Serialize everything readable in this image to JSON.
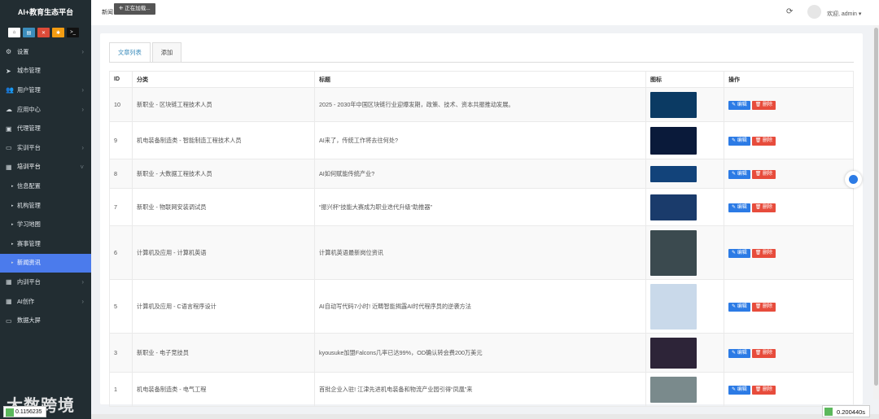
{
  "app": {
    "brand": "AI+教育生态平台",
    "breadcrumb": "新闻",
    "loading": "正在加载...",
    "welcome": "欢迎, admin ▾"
  },
  "sidebar": {
    "items": [
      {
        "label": "设置",
        "icon": "gear-icon",
        "has_arrow": true
      },
      {
        "label": "城市管理",
        "icon": "send-icon",
        "has_arrow": false
      },
      {
        "label": "用户管理",
        "icon": "users-icon",
        "has_arrow": true
      },
      {
        "label": "应用中心",
        "icon": "cloud-icon",
        "has_arrow": true
      },
      {
        "label": "代理管理",
        "icon": "id-card-icon",
        "has_arrow": false
      },
      {
        "label": "实训平台",
        "icon": "monitor-icon",
        "has_arrow": true
      },
      {
        "label": "培训平台",
        "icon": "grid-icon",
        "has_arrow": true,
        "open": true
      },
      {
        "label": "信息配置",
        "sub": true
      },
      {
        "label": "机构管理",
        "sub": true
      },
      {
        "label": "学习地图",
        "sub": true
      },
      {
        "label": "赛事管理",
        "sub": true
      },
      {
        "label": "新闻资讯",
        "sub": true,
        "active": true
      },
      {
        "label": "内训平台",
        "icon": "grid-icon",
        "has_arrow": true
      },
      {
        "label": "AI创作",
        "icon": "grid-icon",
        "has_arrow": true
      },
      {
        "label": "数据大屏",
        "icon": "desktop-icon",
        "has_arrow": false
      }
    ]
  },
  "tabs": [
    "文章列表",
    "添加"
  ],
  "table": {
    "headers": [
      "ID",
      "分类",
      "标题",
      "图标",
      "操作"
    ],
    "edit_label": "✎ 编辑",
    "delete_label": "🗑 删除",
    "rows": [
      {
        "id": "10",
        "category": "新职业 - 区块链工程技术人员",
        "title": "2025 - 2030年中国区块链行业迎爆发期，政策、技术、资本共振推动发展。",
        "thumb_color": "#0b3a63"
      },
      {
        "id": "9",
        "category": "机电装备制造类 - 智能制造工程技术人员",
        "title": "AI来了，传统工作将去往何处?",
        "thumb_color": "#0a1a3a"
      },
      {
        "id": "8",
        "category": "新职业 - 大数据工程技术人员",
        "title": "AI如何赋能传统产业?",
        "thumb_color": "#12437a"
      },
      {
        "id": "7",
        "category": "新职业 - 物联网安装调试员",
        "title": "“振兴杯”技能大赛成为职业迭代升级“助推器”",
        "thumb_color": "#1a3b6b"
      },
      {
        "id": "6",
        "category": "计算机及应用 - 计算机英语",
        "title": "计算机英语最新岗位资讯",
        "thumb_color": "#3b4a4f"
      },
      {
        "id": "5",
        "category": "计算机及应用 - C语言程序设计",
        "title": "AI自动写代码7小时! 近畴智能揭露AI时代程序员的逆袭方法",
        "thumb_color": "#c9d9ea"
      },
      {
        "id": "3",
        "category": "新职业 - 电子竞技员",
        "title": "kyousuke加盟Falcons几率已达99%，OD确认转会费200万美元",
        "thumb_color": "#2d2438"
      },
      {
        "id": "1",
        "category": "机电装备制造类 - 电气工程",
        "title": "首批企业入驻! 江津先进机电装备和物流产业园引得“凤凰”来",
        "thumb_color": "#7a8a8c"
      }
    ]
  },
  "overlay": {
    "watermark": "大数跨境",
    "left_badge": "0.1156235",
    "right_badge": "0.200440s"
  }
}
